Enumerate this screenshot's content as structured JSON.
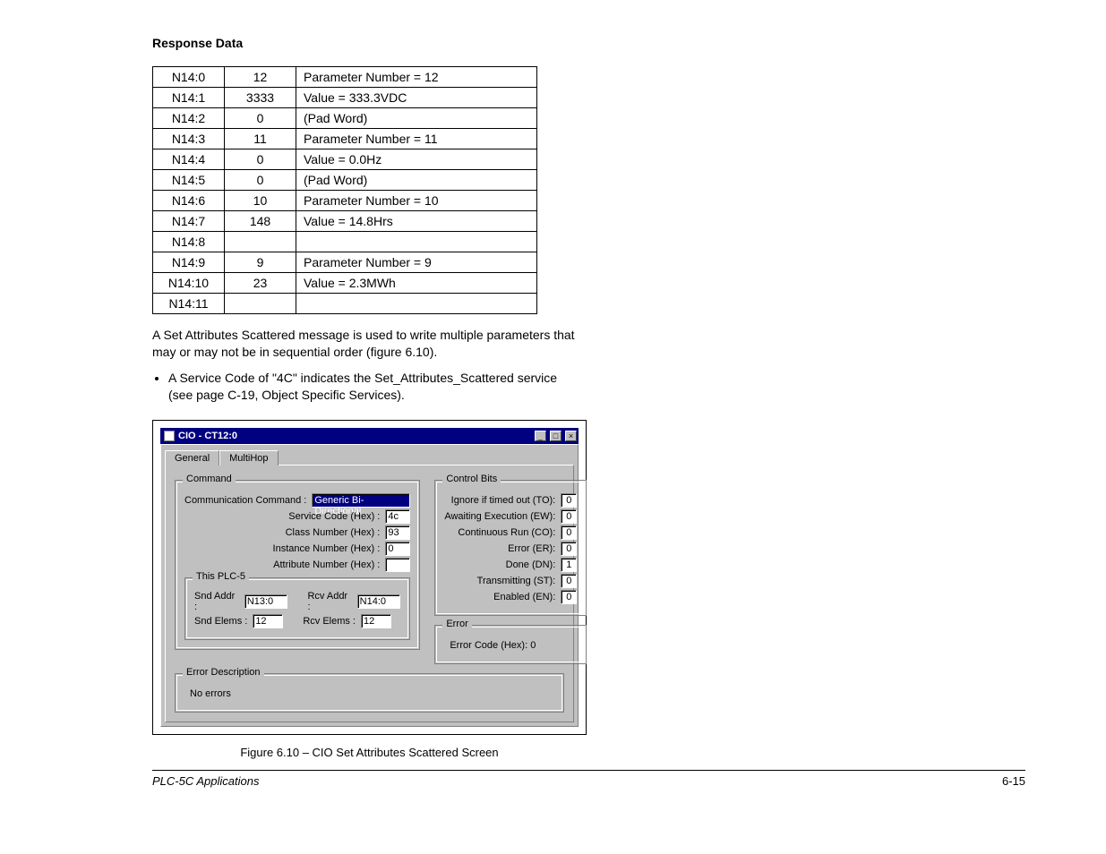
{
  "heading": "Response Data",
  "table": [
    {
      "addr": "N14:0",
      "val": "12",
      "desc": "Parameter Number = 12"
    },
    {
      "addr": "N14:1",
      "val": "3333",
      "desc": "Value = 333.3VDC"
    },
    {
      "addr": "N14:2",
      "val": "0",
      "desc": "(Pad Word)"
    },
    {
      "addr": "N14:3",
      "val": "11",
      "desc": "Parameter Number = 11"
    },
    {
      "addr": "N14:4",
      "val": "0",
      "desc": "Value = 0.0Hz"
    },
    {
      "addr": "N14:5",
      "val": "0",
      "desc": "(Pad Word)"
    },
    {
      "addr": "N14:6",
      "val": "10",
      "desc": "Parameter Number = 10"
    },
    {
      "addr": "N14:7",
      "val": "148",
      "desc": "Value = 14.8Hrs"
    },
    {
      "addr": "N14:8",
      "val": "",
      "desc": ""
    },
    {
      "addr": "N14:9",
      "val": "9",
      "desc": "Parameter Number = 9"
    },
    {
      "addr": "N14:10",
      "val": "23",
      "desc": "Value = 2.3MWh"
    },
    {
      "addr": "N14:11",
      "val": "",
      "desc": ""
    }
  ],
  "para1": "A Set Attributes Scattered message is used to write multiple parameters that may or may not be in sequential order (figure 6.10).",
  "bullet1": "A Service Code of \"4C\" indicates the Set_Attributes_Scattered service (see page C-19, Object Specific Services).",
  "dialog": {
    "title": "CIO - CT12:0",
    "tabs": {
      "general": "General",
      "multihop": "MultiHop"
    },
    "command": {
      "legend": "Command",
      "comm_cmd_label": "Communication Command :",
      "comm_cmd_value": "Generic Bi-Directional",
      "service_label": "Service Code (Hex) :",
      "service_value": "4c",
      "class_label": "Class Number (Hex) :",
      "class_value": "93",
      "instance_label": "Instance Number (Hex) :",
      "instance_value": "0",
      "attr_label": "Attribute Number (Hex) :",
      "attr_value": ""
    },
    "plc5": {
      "legend": "This PLC-5",
      "snd_addr_label": "Snd Addr :",
      "snd_addr_value": "N13:0",
      "rcv_addr_label": "Rcv Addr :",
      "rcv_addr_value": "N14:0",
      "snd_elems_label": "Snd Elems :",
      "snd_elems_value": "12",
      "rcv_elems_label": "Rcv Elems :",
      "rcv_elems_value": "12"
    },
    "control_bits": {
      "legend": "Control Bits",
      "to_label": "Ignore if timed out (TO):",
      "to_val": "0",
      "ew_label": "Awaiting Execution (EW):",
      "ew_val": "0",
      "co_label": "Continuous Run (CO):",
      "co_val": "0",
      "er_label": "Error (ER):",
      "er_val": "0",
      "dn_label": "Done (DN):",
      "dn_val": "1",
      "st_label": "Transmitting (ST):",
      "st_val": "0",
      "en_label": "Enabled (EN):",
      "en_val": "0"
    },
    "error": {
      "legend": "Error",
      "code_label": "Error Code (Hex):  0"
    },
    "error_desc": {
      "legend": "Error Description",
      "text": "No errors"
    }
  },
  "caption": "Figure 6.10 – CIO Set Attributes Scattered Screen",
  "footer": {
    "left": "PLC-5C Applications",
    "right": "6-15"
  }
}
